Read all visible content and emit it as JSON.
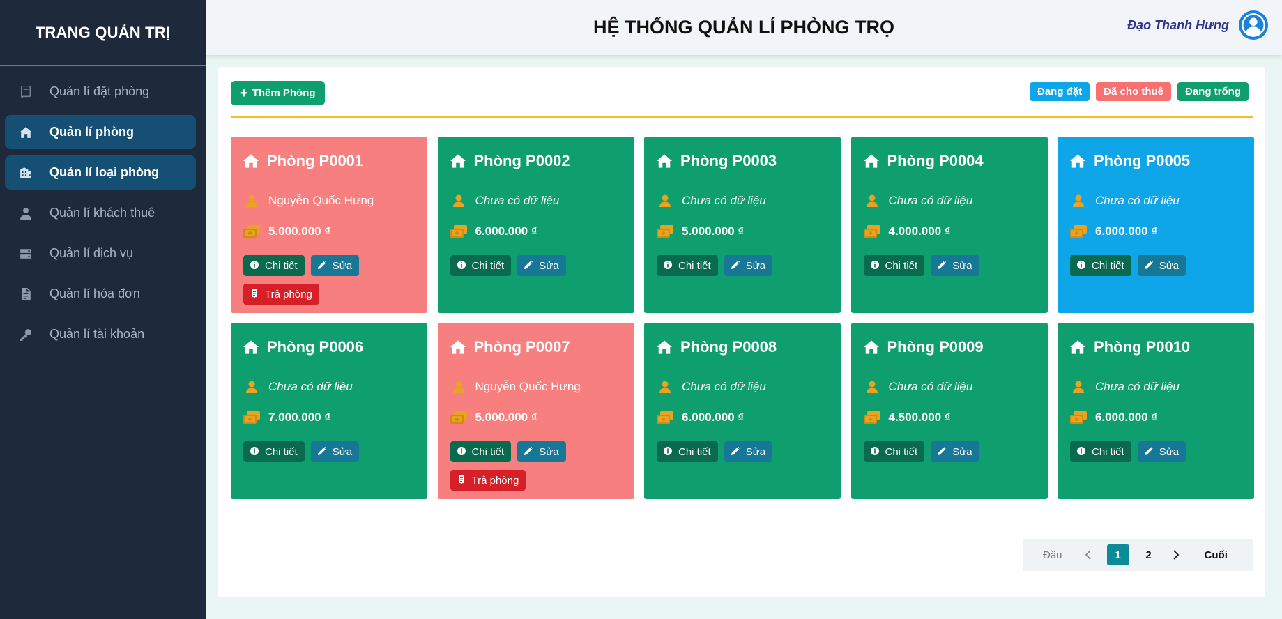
{
  "sidebar": {
    "title": "TRANG QUẢN TRỊ",
    "items": [
      {
        "label": "Quản lí đặt phòng",
        "icon": "book-icon",
        "active": false
      },
      {
        "label": "Quản lí phòng",
        "icon": "home-icon",
        "active": true
      },
      {
        "label": "Quản lí loại phòng",
        "icon": "building-icon",
        "active": true
      },
      {
        "label": "Quản lí khách thuê",
        "icon": "user-icon",
        "active": false
      },
      {
        "label": "Quản lí dịch vụ",
        "icon": "server-icon",
        "active": false
      },
      {
        "label": "Quản lí hóa đơn",
        "icon": "file-icon",
        "active": false
      },
      {
        "label": "Quản lí tài khoản",
        "icon": "key-icon",
        "active": false
      }
    ]
  },
  "header": {
    "title": "HỆ THỐNG QUẢN LÍ PHÒNG TRỌ",
    "user_name": "Đạo Thanh Hưng"
  },
  "toolbar": {
    "add_label": "Thêm Phòng"
  },
  "legend": [
    {
      "label": "Đang đặt",
      "color": "#0ea5e9"
    },
    {
      "label": "Đã cho thuê",
      "color": "#f87171"
    },
    {
      "label": "Đang trống",
      "color": "#0f9f6e"
    }
  ],
  "buttons": {
    "detail": "Chi tiết",
    "edit": "Sửa",
    "return": "Trả phòng"
  },
  "rooms": [
    {
      "name": "Phòng P0001",
      "tenant": "Nguyễn Quốc Hưng",
      "price": "5.000.000 ₫",
      "status": "rented"
    },
    {
      "name": "Phòng P0002",
      "tenant": "Chưa có dữ liệu",
      "price": "6.000.000 ₫",
      "status": "empty"
    },
    {
      "name": "Phòng P0003",
      "tenant": "Chưa có dữ liệu",
      "price": "5.000.000 ₫",
      "status": "empty"
    },
    {
      "name": "Phòng P0004",
      "tenant": "Chưa có dữ liệu",
      "price": "4.000.000 ₫",
      "status": "empty"
    },
    {
      "name": "Phòng P0005",
      "tenant": "Chưa có dữ liệu",
      "price": "6.000.000 ₫",
      "status": "booked"
    },
    {
      "name": "Phòng P0006",
      "tenant": "Chưa có dữ liệu",
      "price": "7.000.000 ₫",
      "status": "empty"
    },
    {
      "name": "Phòng P0007",
      "tenant": "Nguyễn Quốc Hưng",
      "price": "5.000.000 ₫",
      "status": "rented"
    },
    {
      "name": "Phòng P0008",
      "tenant": "Chưa có dữ liệu",
      "price": "6.000.000 ₫",
      "status": "empty"
    },
    {
      "name": "Phòng P0009",
      "tenant": "Chưa có dữ liệu",
      "price": "4.500.000 ₫",
      "status": "empty"
    },
    {
      "name": "Phòng P0010",
      "tenant": "Chưa có dữ liệu",
      "price": "6.000.000 ₫",
      "status": "empty"
    }
  ],
  "status_colors": {
    "booked": "#0ea5e9",
    "rented": "#f87f7f",
    "empty": "#0f9f6e"
  },
  "pagination": {
    "first": "Đầu",
    "last": "Cuối",
    "pages": [
      "1",
      "2"
    ],
    "current": "1"
  }
}
